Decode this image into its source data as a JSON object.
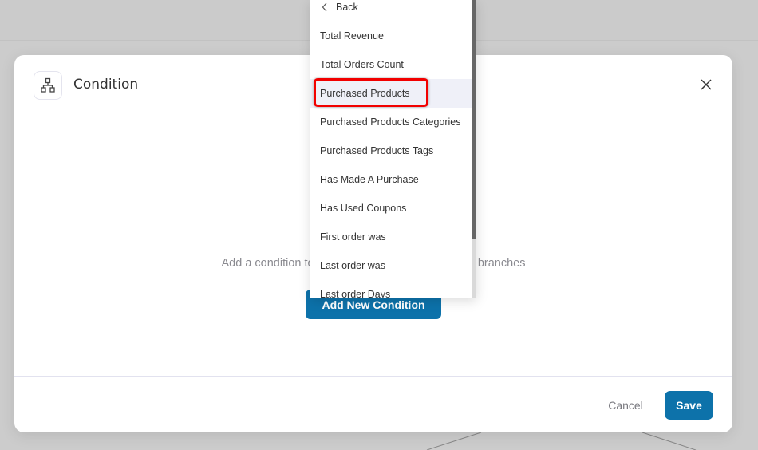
{
  "modal": {
    "title": "Condition",
    "empty_message": "Add a condition to segment contacts into different branches",
    "add_button_label": "Add New Condition",
    "cancel_label": "Cancel",
    "save_label": "Save"
  },
  "dropdown": {
    "back_label": "Back",
    "items": [
      "Total Revenue",
      "Total Orders Count",
      "Purchased Products",
      "Purchased Products Categories",
      "Purchased Products Tags",
      "Has Made A Purchase",
      "Has Used Coupons",
      "First order was",
      "Last order was",
      "Last order Days"
    ],
    "highlighted_item": "Purchased Products"
  },
  "colors": {
    "primary": "#0d72aa",
    "annotation": "#f20000",
    "active_row": "#eff0f8"
  }
}
